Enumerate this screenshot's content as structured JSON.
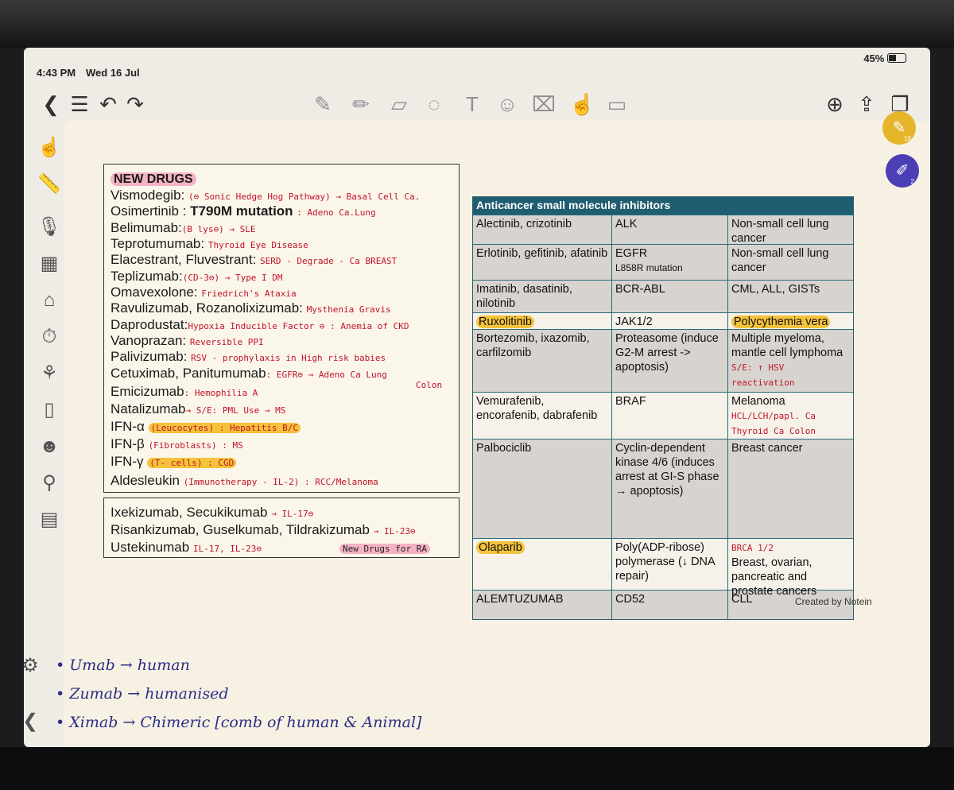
{
  "status": {
    "time": "4:43 PM",
    "date": "Wed 16 Jul",
    "battery": "45%"
  },
  "toolbar": {
    "left": [
      {
        "name": "back-icon",
        "glyph": "❮"
      },
      {
        "name": "outline-icon",
        "glyph": "☰"
      },
      {
        "name": "undo-icon",
        "glyph": "↶"
      },
      {
        "name": "redo-icon",
        "glyph": "↷"
      }
    ],
    "tools": [
      {
        "name": "pen-icon",
        "glyph": "✎"
      },
      {
        "name": "pencil-icon",
        "glyph": "✏"
      },
      {
        "name": "eraser-icon",
        "glyph": "▱"
      },
      {
        "name": "lasso-icon",
        "glyph": "◌"
      },
      {
        "name": "text-icon",
        "glyph": "T"
      },
      {
        "name": "sticker-icon",
        "glyph": "☺"
      },
      {
        "name": "image-icon",
        "glyph": "⌧"
      },
      {
        "name": "hand-icon",
        "glyph": "☝"
      },
      {
        "name": "shape-icon",
        "glyph": "▭"
      }
    ],
    "right": [
      {
        "name": "add-page-icon",
        "glyph": "⊕"
      },
      {
        "name": "share-icon",
        "glyph": "⇪"
      },
      {
        "name": "pages-icon",
        "glyph": "❐"
      }
    ]
  },
  "sidebar": [
    {
      "name": "finger-draw-icon",
      "glyph": "☝"
    },
    {
      "name": "ruler-icon",
      "glyph": "📏"
    },
    {
      "name": "microphone-icon",
      "glyph": "🎙"
    },
    {
      "name": "calculator-icon",
      "glyph": "▦"
    },
    {
      "name": "bookmark-icon",
      "glyph": "⌂"
    },
    {
      "name": "timer-icon",
      "glyph": "⏱"
    },
    {
      "name": "mindmap-icon",
      "glyph": "⚘"
    },
    {
      "name": "document-icon",
      "glyph": "▯"
    },
    {
      "name": "ai-robot-icon",
      "glyph": "☻"
    },
    {
      "name": "search-icon",
      "glyph": "⚲"
    },
    {
      "name": "presentation-icon",
      "glyph": "▤"
    },
    {
      "name": "settings-icon",
      "glyph": "⚙"
    },
    {
      "name": "collapse-icon",
      "glyph": "❮"
    }
  ],
  "fab": {
    "pen_count": "19",
    "brush_count": "2",
    "pen_color": "#e6b52a",
    "brush_color": "#4a3fb5"
  },
  "new_drugs": {
    "title": "NEW DRUGS",
    "lines": [
      {
        "drug": "Vismodegib:",
        "note": "(⊖ Sonic Hedge Hog Pathway) → Basal Cell Ca."
      },
      {
        "drug": "Osimertinib :",
        "bold": "T790M mutation",
        "note": ": Adeno Ca.Lung"
      },
      {
        "drug": "Belimumab:",
        "note": "(B lys⊖) → SLE"
      },
      {
        "drug": "Teprotumumab:",
        "note": "Thyroid Eye Disease"
      },
      {
        "drug": "Elacestrant, Fluvestrant:",
        "note": "SERD - Degrade - Ca BREAST"
      },
      {
        "drug": "Teplizumab:",
        "note": "(CD-3⊖) → Type I DM"
      },
      {
        "drug": "Omavexolone:",
        "note": "Friedrich's Ataxia"
      },
      {
        "drug": "Ravulizumab, Rozanolixizumab:",
        "note": "Mysthenia Gravis"
      },
      {
        "drug": "Daprodustat:",
        "note": "Hypoxia Inducible Factor ⊖ : Anemia of CKD"
      },
      {
        "drug": "Vanoprazan:",
        "note": "Reversible PPI"
      },
      {
        "drug": "Palivizumab:",
        "note": "RSV - prophylaxis in High risk babies"
      },
      {
        "drug": "Cetuximab, Panitumumab",
        "note": ": EGFR⊖ → Adeno Ca Lung"
      },
      {
        "drug": "Emicizumab",
        "note": ": Hemophilia A"
      },
      {
        "drug": "Natalizumab",
        "note": "→ S/E: PML  Use → MS"
      },
      {
        "drug": "IFN-α",
        "note": "(Leucocytes) : Hepatitis B/C"
      },
      {
        "drug": "IFN-β",
        "note": "(Fibroblasts) : MS"
      },
      {
        "drug": "IFN-γ",
        "note": "(T- cells) : CGD"
      },
      {
        "drug": "Aldesleukin",
        "note": "(Immunotherapy - IL-2) : RCC/Melanoma"
      }
    ],
    "cetux_extra": "Colon"
  },
  "il_box": {
    "line1_drug": "Ixekizumab, Secukikumab",
    "line1_note": "→ IL-17⊖",
    "line2_drug": "Risankizumab, Guselkumab, Tildrakizumab",
    "line2_note": "→ IL-23⊖",
    "line3_drug": "Ustekinumab",
    "line3_note": "IL-17, IL-23⊖",
    "tag": "New Drugs for RA"
  },
  "kinase_table": {
    "title": "Anticancer small molecule inhibitors",
    "rows": [
      {
        "drug": "Alectinib, crizotinib",
        "target": "ALK",
        "use": "Non-small cell lung cancer"
      },
      {
        "drug": "Erlotinib, gefitinib, afatinib",
        "target": "EGFR",
        "target_sub": "L858R mutation",
        "use": "Non-small cell lung cancer"
      },
      {
        "drug": "Imatinib, dasatinib, nilotinib",
        "target": "BCR-ABL",
        "use": "CML, ALL, GISTs"
      },
      {
        "drug": "Ruxolitinib",
        "target": "JAK1/2",
        "use": "Polycythemia vera"
      },
      {
        "drug": "Bortezomib, ixazomib, carfilzomib",
        "target": "Proteasome (induce G2-M arrest -> apoptosis)",
        "use": "Multiple myeloma, mantle cell lymphoma",
        "use_note": "S/E: ↑ HSV reactivation"
      },
      {
        "drug": "Vemurafenib, encorafenib, dabrafenib",
        "target": "BRAF",
        "use": "Melanoma",
        "use_note": "HCL/LCH/papl. Ca Thyroid Ca Colon"
      },
      {
        "drug": "Palbociclib",
        "target": "Cyclin-dependent kinase 4/6 (induces arrest at GI-S phase → apoptosis)",
        "use": "Breast cancer"
      },
      {
        "drug": "Olaparib",
        "target": "Poly(ADP-ribose) polymerase (↓ DNA repair)",
        "use": "Breast, ovarian, pancreatic and prostate cancers",
        "use_note": "BRCA 1/2"
      },
      {
        "drug": "ALEMTUZUMAB",
        "target": "CD52",
        "use": "CLL"
      }
    ],
    "credit": "Created by Notein"
  },
  "notes": [
    "• Umab → human",
    "• Zumab → humanised",
    "• Ximab → Chimeric [comb of human & Animal]"
  ]
}
